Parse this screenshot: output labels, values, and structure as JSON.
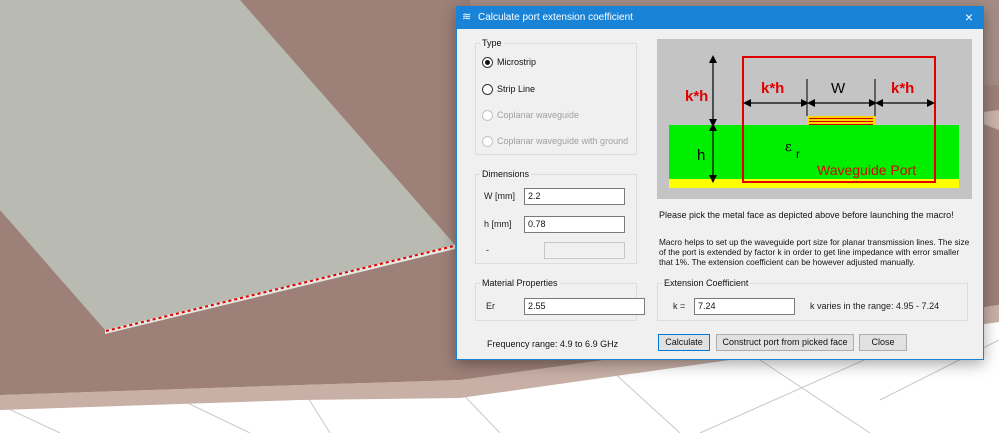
{
  "dialog": {
    "title": "Calculate port extension coefficient",
    "title_icon": "waveguide-port-icon",
    "close_glyph": "×"
  },
  "type_group": {
    "label": "Type",
    "options": [
      {
        "label": "Microstrip",
        "checked": true,
        "enabled": true
      },
      {
        "label": "Strip Line",
        "checked": false,
        "enabled": true
      },
      {
        "label": "Coplanar waveguide",
        "checked": false,
        "enabled": false
      },
      {
        "label": "Coplanar waveguide with ground",
        "checked": false,
        "enabled": false
      }
    ]
  },
  "dimensions_group": {
    "label": "Dimensions",
    "w_label": "W [mm]",
    "w_value": "2.2",
    "h_label": "h [mm]",
    "h_value": "0.78",
    "third_label": "-",
    "third_value": ""
  },
  "material_group": {
    "label": "Material Properties",
    "er_label": "Er",
    "er_value": "2.55"
  },
  "frequency_range": "Frequency range: 4.9 to 6.9 GHz",
  "diagram": {
    "k_h_left": "k*h",
    "k_h_mid": "k*h",
    "w_label": "W",
    "k_h_right": "k*h",
    "h_label": "h",
    "epsilon_label": "ε",
    "epsilon_sub": "r",
    "port_label": "Waveguide Port"
  },
  "instructions": {
    "pick_note": "Please pick the metal face as depicted above before launching the macro!",
    "description": "Macro helps to set up the waveguide port size for planar transmission lines. The size of the port is extended by factor k in order to get line impedance with error smaller that 1%. The extension coefficient can be however adjusted manually."
  },
  "extension_group": {
    "label": "Extension Coefficient",
    "k_label": "k =",
    "k_value": "7.24",
    "range_text": "k varies in the range: 4.95 - 7.24"
  },
  "buttons": {
    "calculate": "Calculate",
    "construct": "Construct port from picked face",
    "close": "Close"
  },
  "colors": {
    "titlebar": "#1883d7",
    "substrate": "#00ee00",
    "ground": "#ffff00",
    "port_outline": "#e00000",
    "strip": "#ffd400"
  }
}
